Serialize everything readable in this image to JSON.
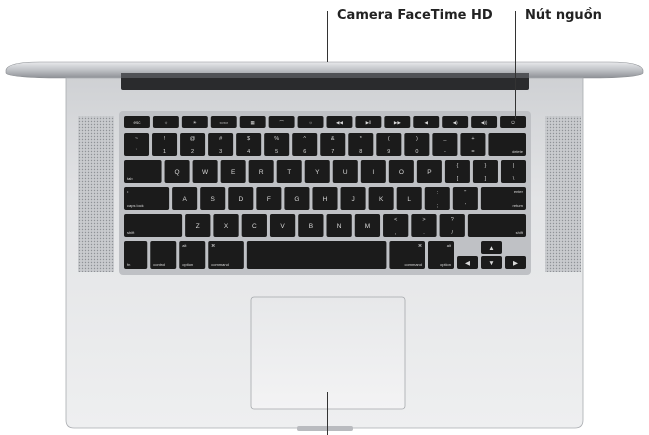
{
  "callouts": {
    "camera": "Camera FaceTime HD",
    "power": "Nút nguồn"
  },
  "keyboard": {
    "fn_row": [
      {
        "icon": "escape",
        "label": "esc"
      },
      {
        "icon": "brightness-down",
        "label": "☼"
      },
      {
        "icon": "brightness-up",
        "label": "☀"
      },
      {
        "icon": "mission-control",
        "label": "▭▭"
      },
      {
        "icon": "launchpad",
        "label": "▦"
      },
      {
        "icon": "keyboard-light-down",
        "label": "⌒"
      },
      {
        "icon": "keyboard-light-up",
        "label": "☼"
      },
      {
        "icon": "rewind",
        "label": "◀◀"
      },
      {
        "icon": "play-pause",
        "label": "▶ll"
      },
      {
        "icon": "fast-forward",
        "label": "▶▶"
      },
      {
        "icon": "mute",
        "label": "◀"
      },
      {
        "icon": "volume-down",
        "label": "◀)"
      },
      {
        "icon": "volume-up",
        "label": "◀))"
      },
      {
        "icon": "power",
        "label": "⏻"
      }
    ],
    "number_row": [
      {
        "top": "~",
        "bottom": "`"
      },
      {
        "top": "!",
        "bottom": "1"
      },
      {
        "top": "@",
        "bottom": "2"
      },
      {
        "top": "#",
        "bottom": "3"
      },
      {
        "top": "$",
        "bottom": "4"
      },
      {
        "top": "%",
        "bottom": "5"
      },
      {
        "top": "^",
        "bottom": "6"
      },
      {
        "top": "&",
        "bottom": "7"
      },
      {
        "top": "*",
        "bottom": "8"
      },
      {
        "top": "(",
        "bottom": "9"
      },
      {
        "top": ")",
        "bottom": "0"
      },
      {
        "top": "_",
        "bottom": "-"
      },
      {
        "top": "+",
        "bottom": "="
      },
      {
        "top": "",
        "bottom": "delete"
      }
    ],
    "qwerty_row": [
      {
        "top": "",
        "bottom": "tab"
      },
      {
        "top": "",
        "bottom": "Q"
      },
      {
        "top": "",
        "bottom": "W"
      },
      {
        "top": "",
        "bottom": "E"
      },
      {
        "top": "",
        "bottom": "R"
      },
      {
        "top": "",
        "bottom": "T"
      },
      {
        "top": "",
        "bottom": "Y"
      },
      {
        "top": "",
        "bottom": "U"
      },
      {
        "top": "",
        "bottom": "I"
      },
      {
        "top": "",
        "bottom": "O"
      },
      {
        "top": "",
        "bottom": "P"
      },
      {
        "top": "{",
        "bottom": "["
      },
      {
        "top": "}",
        "bottom": "]"
      },
      {
        "top": "|",
        "bottom": "\\"
      }
    ],
    "home_row": [
      {
        "top": "•",
        "bottom": "caps lock"
      },
      {
        "top": "",
        "bottom": "A"
      },
      {
        "top": "",
        "bottom": "S"
      },
      {
        "top": "",
        "bottom": "D"
      },
      {
        "top": "",
        "bottom": "F"
      },
      {
        "top": "",
        "bottom": "G"
      },
      {
        "top": "",
        "bottom": "H"
      },
      {
        "top": "",
        "bottom": "J"
      },
      {
        "top": "",
        "bottom": "K"
      },
      {
        "top": "",
        "bottom": "L"
      },
      {
        "top": ":",
        "bottom": ";"
      },
      {
        "top": "\"",
        "bottom": "'"
      },
      {
        "top": "enter",
        "bottom": "return"
      }
    ],
    "shift_row": [
      {
        "top": "",
        "bottom": "shift"
      },
      {
        "top": "",
        "bottom": "Z"
      },
      {
        "top": "",
        "bottom": "X"
      },
      {
        "top": "",
        "bottom": "C"
      },
      {
        "top": "",
        "bottom": "V"
      },
      {
        "top": "",
        "bottom": "B"
      },
      {
        "top": "",
        "bottom": "N"
      },
      {
        "top": "",
        "bottom": "M"
      },
      {
        "top": "<",
        "bottom": ","
      },
      {
        "top": ">",
        "bottom": "."
      },
      {
        "top": "?",
        "bottom": "/"
      },
      {
        "top": "",
        "bottom": "shift"
      }
    ],
    "bottom_row": [
      {
        "top": "",
        "bottom": "fn"
      },
      {
        "top": "",
        "bottom": "control"
      },
      {
        "top": "alt",
        "bottom": "option"
      },
      {
        "top": "⌘",
        "bottom": "command"
      },
      {
        "top": "",
        "bottom": ""
      },
      {
        "top": "⌘",
        "bottom": "command"
      },
      {
        "top": "alt",
        "bottom": "option"
      }
    ],
    "arrows": {
      "left": "◀",
      "up": "▲",
      "down": "▼",
      "right": "▶"
    }
  },
  "colors": {
    "key": "#1b1b1b",
    "key_label": "#d9d9d9",
    "body": "#d4d6d9",
    "line": "#333333"
  }
}
